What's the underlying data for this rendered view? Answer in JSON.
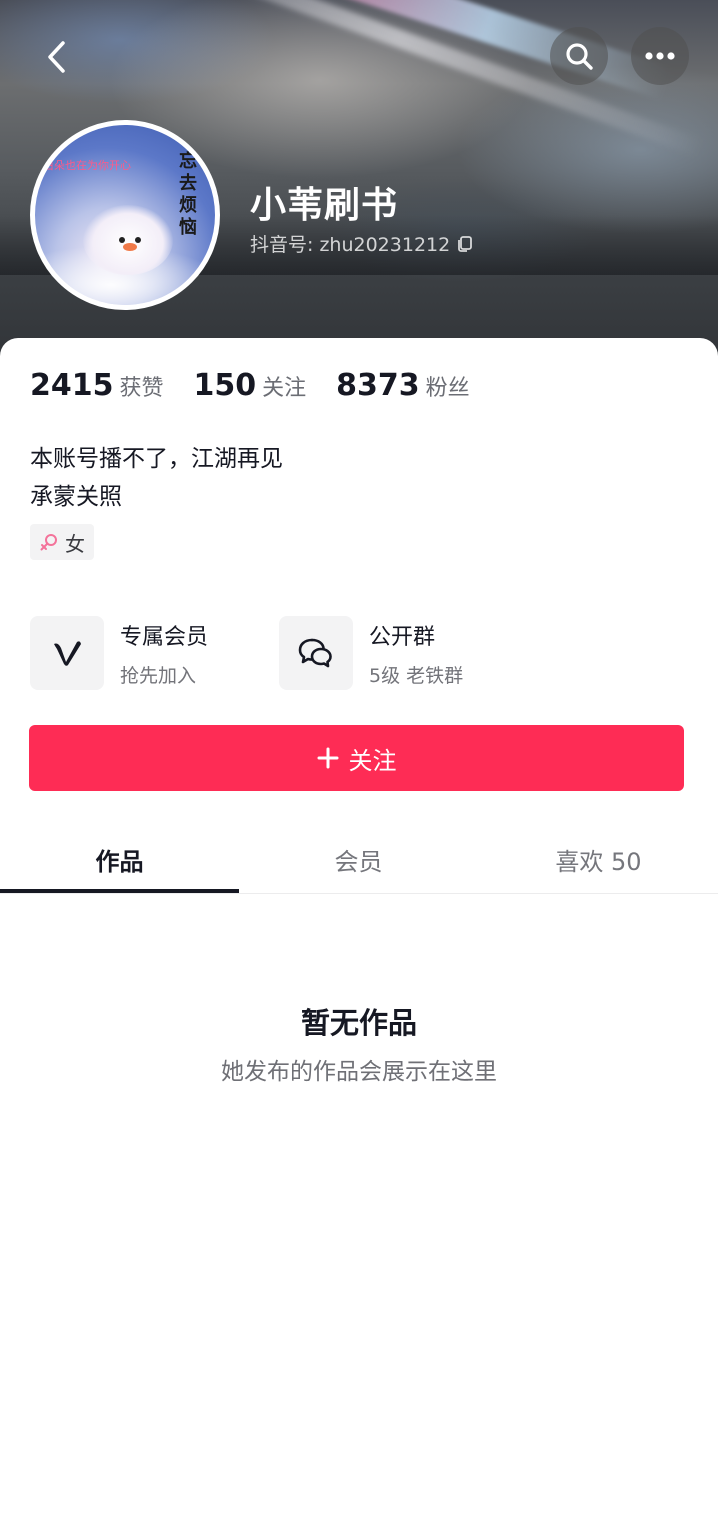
{
  "profile": {
    "nickname": "小苇刷书",
    "account_id": "抖音号: zhu20231212",
    "avatar_caption_line1": "白朵也在为你开心",
    "avatar_caption_line2": "忘去烦恼",
    "bio_line1": "本账号播不了，江湖再见",
    "bio_line2": "承蒙关照",
    "gender": "女"
  },
  "stats": [
    {
      "value": "2415",
      "label": "获赞"
    },
    {
      "value": "150",
      "label": "关注"
    },
    {
      "value": "8373",
      "label": "粉丝"
    }
  ],
  "features": [
    {
      "title": "专属会员",
      "subtitle": "抢先加入",
      "icon": "vip-v-icon"
    },
    {
      "title": "公开群",
      "subtitle": "5级 老铁群",
      "icon": "group-chat-icon"
    }
  ],
  "follow_button": {
    "label": "关注",
    "icon": "plus-icon"
  },
  "tabs": [
    {
      "label": "作品",
      "active": true
    },
    {
      "label": "会员",
      "active": false
    },
    {
      "label": "喜欢 50",
      "active": false
    }
  ],
  "empty_state": {
    "title": "暂无作品",
    "subtitle": "她发布的作品会展示在这里"
  },
  "colors": {
    "accent": "#fe2c55",
    "text_primary": "#161823",
    "text_secondary": "#6b6d74",
    "panel_bg": "#ffffff",
    "chip_bg": "#f3f3f4",
    "gender_icon": "#f3739a"
  }
}
